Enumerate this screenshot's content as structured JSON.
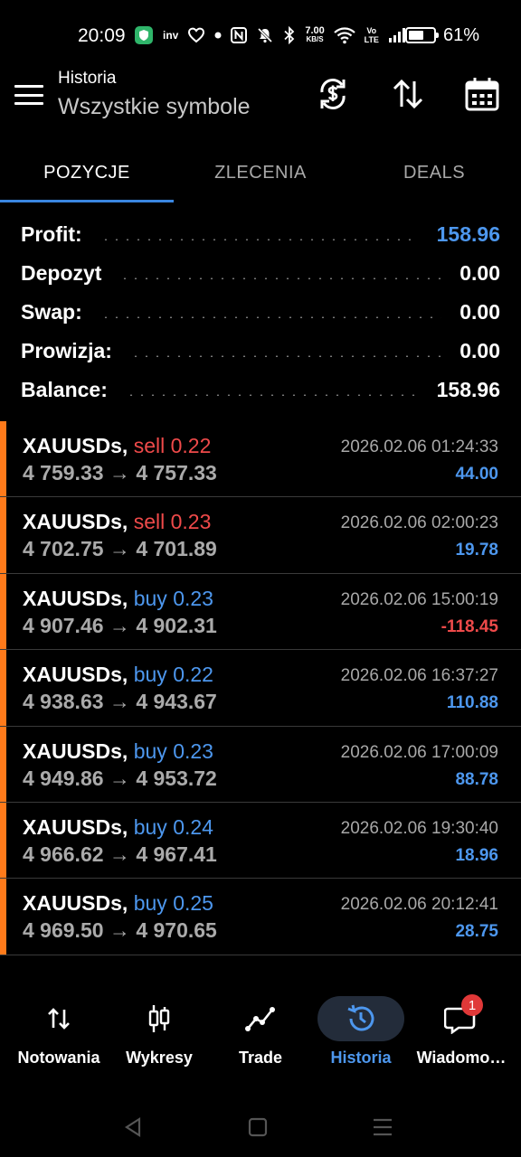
{
  "status_bar": {
    "time": "20:09",
    "inv_label": "inv",
    "net_speed": "7.00",
    "net_unit": "KB/S",
    "volte": "Vo LTE",
    "battery_percent": "61%",
    "battery_level": 0.61
  },
  "header": {
    "title": "Historia",
    "subtitle": "Wszystkie symbole"
  },
  "tabs": [
    "POZYCJE",
    "ZLECENIA",
    "DEALS"
  ],
  "active_tab": 0,
  "summary": [
    {
      "label": "Profit:",
      "value": "158.96",
      "highlight": true
    },
    {
      "label": "Depozyt",
      "value": "0.00",
      "highlight": false
    },
    {
      "label": "Swap:",
      "value": "0.00",
      "highlight": false
    },
    {
      "label": "Prowizja:",
      "value": "0.00",
      "highlight": false
    },
    {
      "label": "Balance:",
      "value": "158.96",
      "highlight": false
    }
  ],
  "trades": [
    {
      "symbol": "XAUUSDs,",
      "dir": "sell",
      "volume": "0.22",
      "open": "4 759.33",
      "close": "4 757.33",
      "time": "2026.02.06 01:24:33",
      "profit": "44.00"
    },
    {
      "symbol": "XAUUSDs,",
      "dir": "sell",
      "volume": "0.23",
      "open": "4 702.75",
      "close": "4 701.89",
      "time": "2026.02.06 02:00:23",
      "profit": "19.78"
    },
    {
      "symbol": "XAUUSDs,",
      "dir": "buy",
      "volume": "0.23",
      "open": "4 907.46",
      "close": "4 902.31",
      "time": "2026.02.06 15:00:19",
      "profit": "-118.45"
    },
    {
      "symbol": "XAUUSDs,",
      "dir": "buy",
      "volume": "0.22",
      "open": "4 938.63",
      "close": "4 943.67",
      "time": "2026.02.06 16:37:27",
      "profit": "110.88"
    },
    {
      "symbol": "XAUUSDs,",
      "dir": "buy",
      "volume": "0.23",
      "open": "4 949.86",
      "close": "4 953.72",
      "time": "2026.02.06 17:00:09",
      "profit": "88.78"
    },
    {
      "symbol": "XAUUSDs,",
      "dir": "buy",
      "volume": "0.24",
      "open": "4 966.62",
      "close": "4 967.41",
      "time": "2026.02.06 19:30:40",
      "profit": "18.96"
    },
    {
      "symbol": "XAUUSDs,",
      "dir": "buy",
      "volume": "0.25",
      "open": "4 969.50",
      "close": "4 970.65",
      "time": "2026.02.06 20:12:41",
      "profit": "28.75"
    }
  ],
  "arrow": "→",
  "bottom_nav": [
    {
      "label": "Notowania",
      "icon": "quotes-arrows-icon",
      "active": false
    },
    {
      "label": "Wykresy",
      "icon": "candlestick-icon",
      "active": false
    },
    {
      "label": "Trade",
      "icon": "trade-line-icon",
      "active": false
    },
    {
      "label": "Historia",
      "icon": "history-clock-icon",
      "active": true
    },
    {
      "label": "Wiadomo…",
      "icon": "chat-bubble-icon",
      "active": false,
      "badge": "1"
    }
  ],
  "colors": {
    "accent_blue": "#4d97ee",
    "loss_red": "#ef4a4a",
    "trade_bar_orange": "#ff7a1a",
    "tab_indicator": "#3a86e0"
  }
}
